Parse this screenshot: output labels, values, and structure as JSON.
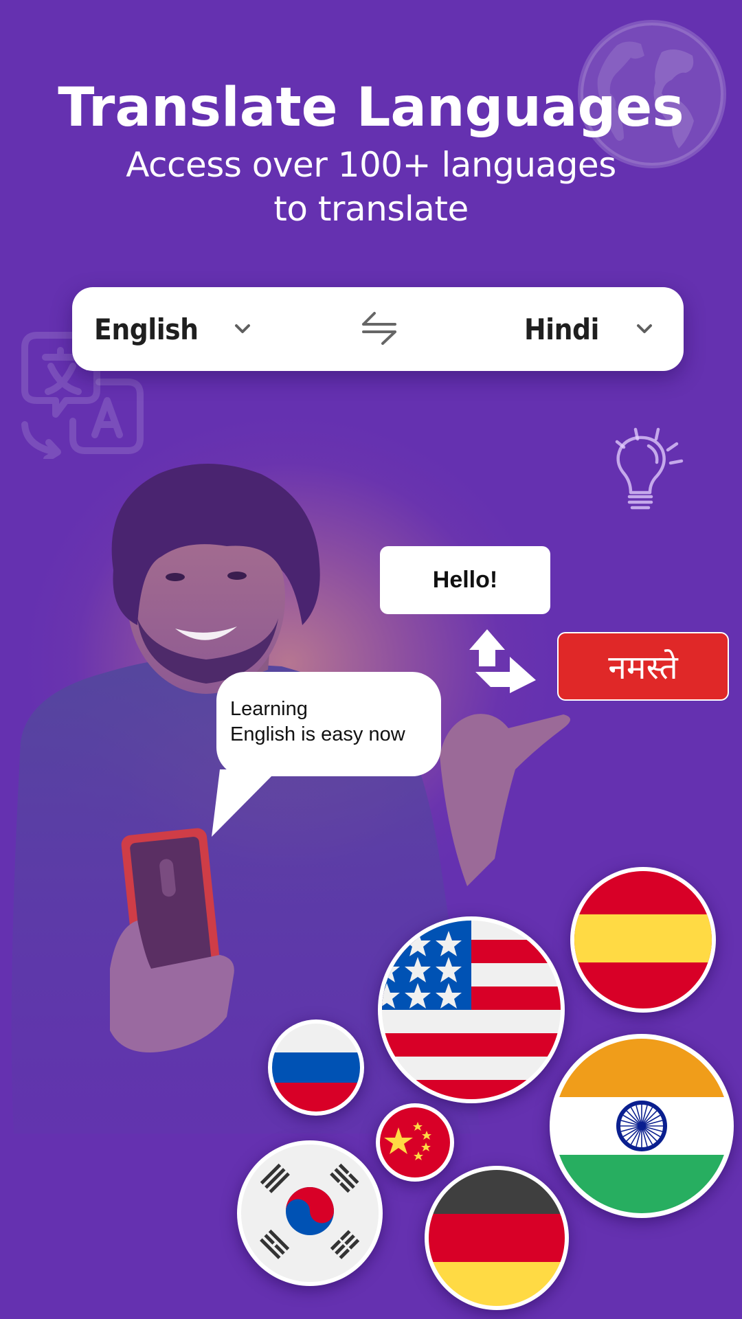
{
  "header": {
    "title": "Translate Languages",
    "subtitle_line1": "Access over 100+ languages",
    "subtitle_line2": "to translate"
  },
  "language_selector": {
    "source_language": "English",
    "target_language": "Hindi",
    "source_icon": "chevron-down-icon",
    "target_icon": "chevron-down-icon",
    "swap_icon": "swap-arrows-icon"
  },
  "illustration": {
    "speech_bubble_line1": "Learning",
    "speech_bubble_line2": "English is easy now",
    "source_phrase": "Hello!",
    "translated_phrase": "नमस्ते",
    "translate_arrows_icon": "translate-arrows-icon"
  },
  "decorations": {
    "globe_icon": "globe-icon",
    "translate_icon": "translate-icon",
    "bulb_icon": "lightbulb-icon"
  },
  "flags": [
    {
      "country": "Spain",
      "name": "flag-spain"
    },
    {
      "country": "United States",
      "name": "flag-usa"
    },
    {
      "country": "Russia",
      "name": "flag-russia"
    },
    {
      "country": "India",
      "name": "flag-india"
    },
    {
      "country": "China",
      "name": "flag-china"
    },
    {
      "country": "South Korea",
      "name": "flag-south-korea"
    },
    {
      "country": "Germany",
      "name": "flag-germany"
    }
  ],
  "colors": {
    "background": "#6531B0",
    "hindi_bubble": "#E02828",
    "flag_red": "#D80027",
    "flag_blue": "#0052B4",
    "flag_yellow": "#FFDA44",
    "india_saffron": "#F09D1A",
    "india_green": "#27AE60",
    "germany_black": "#3F3F3F"
  }
}
